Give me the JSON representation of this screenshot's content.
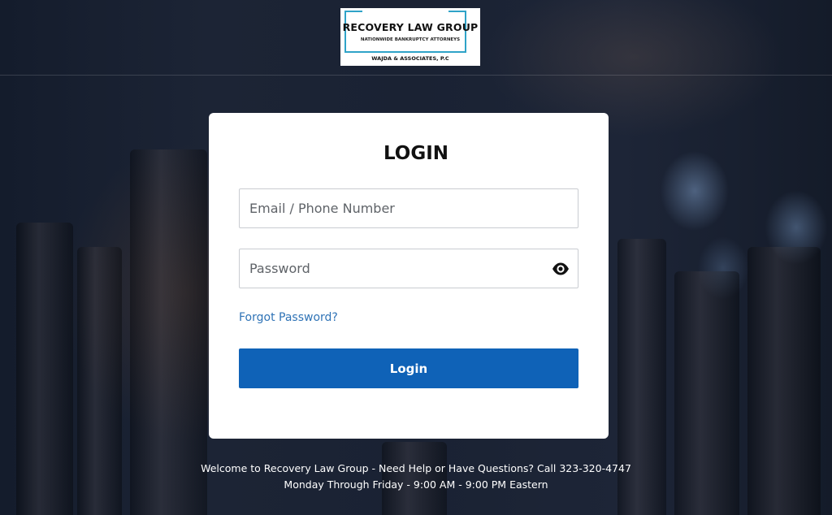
{
  "logo": {
    "title": "RECOVERY LAW GROUP",
    "tagline": "NATIONWIDE BANKRUPTCY ATTORNEYS",
    "subtitle": "WAJDA & ASSOCIATES, P.C",
    "frame_color": "#2fa3c8"
  },
  "login_card": {
    "title": "LOGIN",
    "email_placeholder": "Email / Phone Number",
    "email_value": "",
    "password_placeholder": "Password",
    "password_value": "",
    "password_toggle_icon": "eye-icon",
    "forgot_link": "Forgot Password?",
    "submit_label": "Login"
  },
  "footer": {
    "line1": "Welcome to Recovery Law Group - Need Help or Have Questions? Call 323-320-4747",
    "line2": "Monday Through Friday - 9:00 AM - 9:00 PM Eastern"
  },
  "colors": {
    "background": "#1a2336",
    "primary_button": "#0f62b7",
    "link": "#2f73b6",
    "card": "#ffffff"
  }
}
